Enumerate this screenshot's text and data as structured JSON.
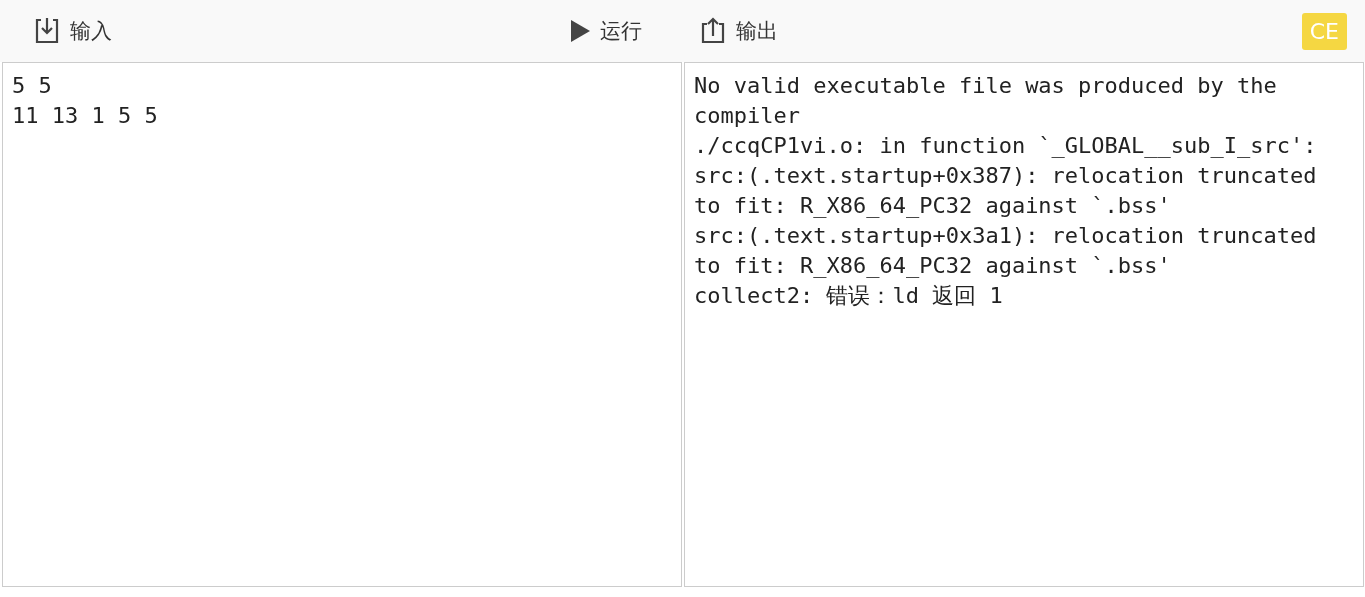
{
  "toolbar": {
    "buttons": [
      {
        "kind": "input",
        "label": "输入"
      },
      {
        "kind": "run",
        "label": "运行"
      },
      {
        "kind": "output",
        "label": "输出"
      }
    ],
    "status_badge": "CE"
  },
  "input_panel": {
    "lines": [
      "5 5",
      "11 13 1 5 5"
    ]
  },
  "output_panel": {
    "lines": [
      "No valid executable file was produced by the compiler",
      "./ccqCP1vi.o: in function `_GLOBAL__sub_I_src':",
      "src:(.text.startup+0x387): relocation truncated to fit: R_X86_64_PC32 against `.bss'",
      "src:(.text.startup+0x3a1): relocation truncated to fit: R_X86_64_PC32 against `.bss'",
      "collect2: 错误：ld 返回 1"
    ]
  }
}
